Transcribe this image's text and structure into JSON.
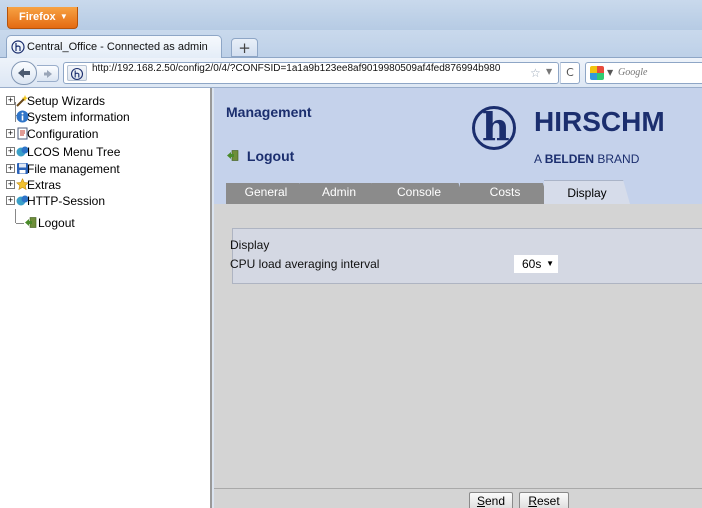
{
  "browser": {
    "menu_label": "Firefox",
    "tab_title": "Central_Office - Connected as admin",
    "new_tab_symbol": "+",
    "url": "http://192.168.2.50/config2/0/4/?CONFSID=1a1a9b123ee8af9019980509af4fed876994b980",
    "search_placeholder": "Google",
    "icons": {
      "back": "back-arrow-icon",
      "forward": "forward-arrow-icon",
      "site": "hirschmann-favicon-icon",
      "bookmark": "star-icon",
      "reload": "reload-icon"
    }
  },
  "tree": {
    "items": [
      {
        "label": "Setup Wizards",
        "icon": "wizard-wand-icon",
        "expandable": true
      },
      {
        "label": "System information",
        "icon": "info-icon",
        "expandable": false
      },
      {
        "label": "Configuration",
        "icon": "config-document-icon",
        "expandable": true
      },
      {
        "label": "LCOS Menu Tree",
        "icon": "menu-tree-icon",
        "expandable": true
      },
      {
        "label": "File management",
        "icon": "floppy-disk-icon",
        "expandable": true
      },
      {
        "label": "Extras",
        "icon": "star-folder-icon",
        "expandable": true
      },
      {
        "label": "HTTP-Session",
        "icon": "session-icon",
        "expandable": true
      },
      {
        "label": "Logout",
        "icon": "logout-icon",
        "expandable": false
      }
    ]
  },
  "content": {
    "section_title": "Management",
    "logout_label": "Logout",
    "brand": {
      "name": "HIRSCHM",
      "sub_prefix": "A ",
      "sub_bold": "BELDEN",
      "sub_suffix": " BRAND"
    },
    "tabs": [
      {
        "label": "General",
        "active": false
      },
      {
        "label": "Admin",
        "active": false
      },
      {
        "label": "Console",
        "active": false
      },
      {
        "label": "Costs",
        "active": false
      },
      {
        "label": "Display",
        "active": true
      }
    ],
    "form": {
      "legend": "Display",
      "cpu_label": "CPU load averaging interval",
      "cpu_value": "60s"
    },
    "buttons": {
      "send": {
        "mnemonic": "S",
        "rest": "end"
      },
      "reset": {
        "mnemonic": "R",
        "rest": "eset"
      }
    }
  },
  "colors": {
    "brand_blue": "#1b2e6e",
    "header_bg": "#c5d2eb",
    "tab_inactive": "#8b8b8b",
    "firefox_orange": "#e46a12"
  }
}
